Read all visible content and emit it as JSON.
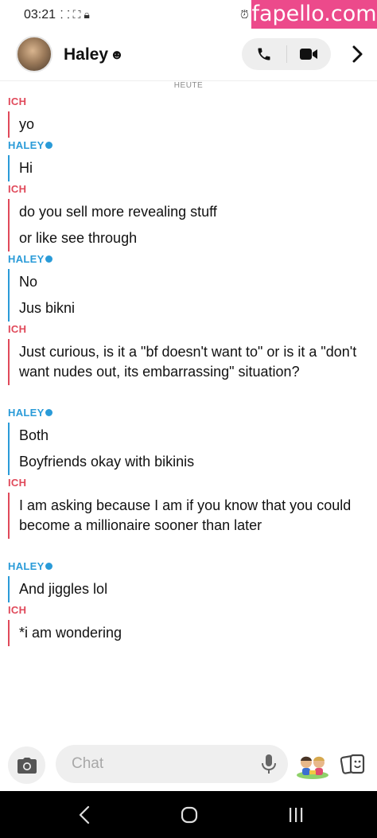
{
  "status_bar": {
    "time": "03:21",
    "icons": [
      "screen-record-icon",
      "focus-icon",
      "lock-icon"
    ],
    "watermark": "fapello.com"
  },
  "header": {
    "contact_name": "Haley",
    "name_emoji": "☻"
  },
  "chat": {
    "day_label": "HEUTE",
    "groups": [
      {
        "sender": "ICH",
        "from": "me",
        "messages": [
          "yo"
        ]
      },
      {
        "sender": "HALEY",
        "from": "her",
        "messages": [
          "Hi"
        ]
      },
      {
        "sender": "ICH",
        "from": "me",
        "messages": [
          "do you sell more revealing stuff",
          "or like see through"
        ]
      },
      {
        "sender": "HALEY",
        "from": "her",
        "messages": [
          "No",
          "Jus bikni"
        ]
      },
      {
        "sender": "ICH",
        "from": "me",
        "messages": [
          "Just curious, is it a \"bf doesn't want to\" or is it a \"don't want nudes out, its embarrassing\" situation?"
        ]
      },
      {
        "sender": "HALEY",
        "from": "her",
        "messages": [
          "Both",
          "Boyfriends okay with bikinis"
        ]
      },
      {
        "sender": "ICH",
        "from": "me",
        "messages": [
          "I am asking because I am if you know that you could become a millionaire sooner than later"
        ]
      },
      {
        "sender": "HALEY",
        "from": "her",
        "messages": [
          "And jiggles lol"
        ]
      },
      {
        "sender": "ICH",
        "from": "me",
        "messages": [
          "*i am wondering"
        ]
      }
    ]
  },
  "input_bar": {
    "placeholder": "Chat"
  },
  "colors": {
    "me": "#e0495a",
    "her": "#2a9bd8",
    "watermark_bg": "#ec4a8b"
  }
}
